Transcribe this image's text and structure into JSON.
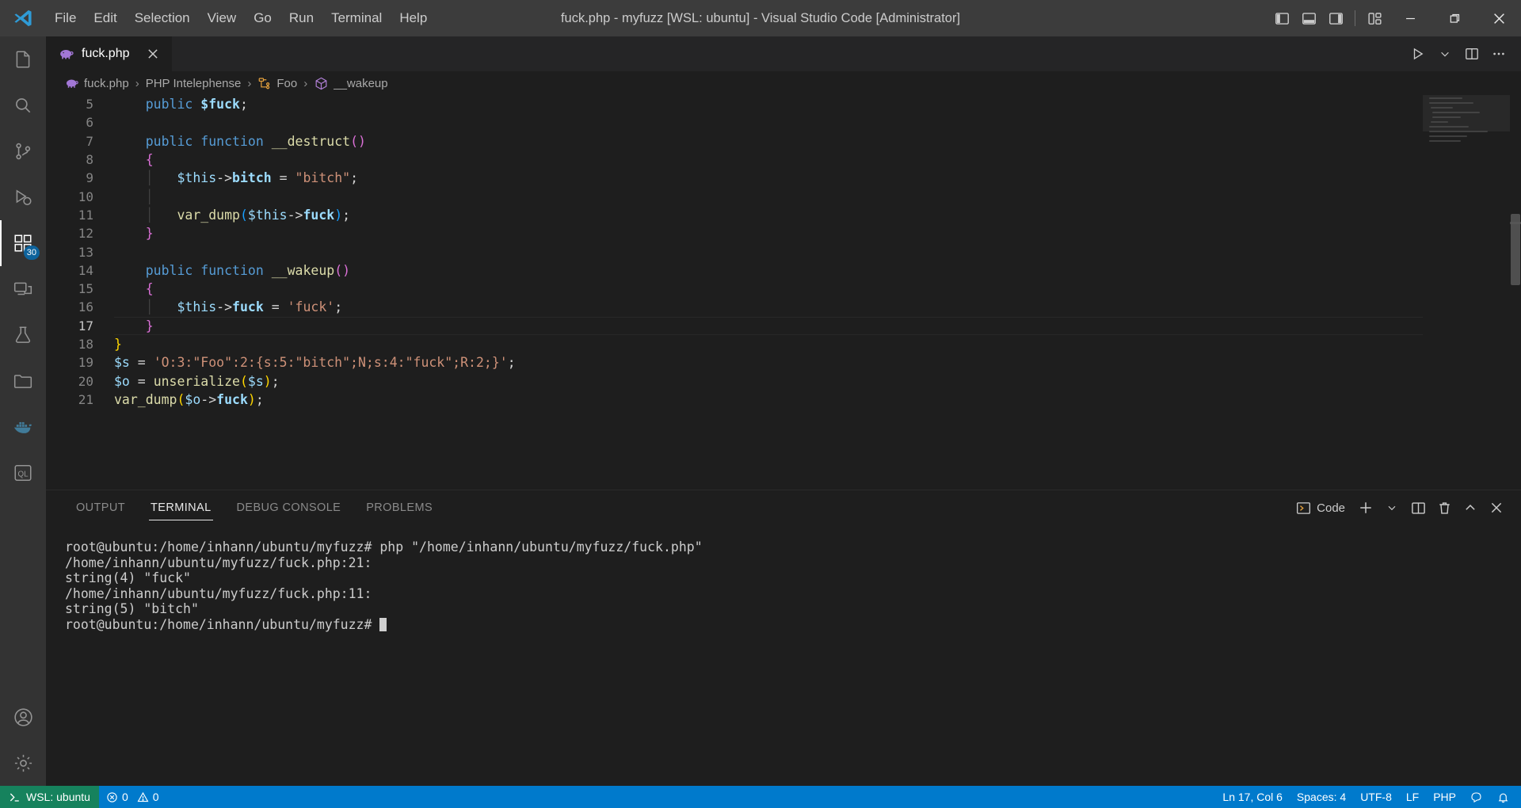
{
  "window": {
    "title": "fuck.php - myfuzz [WSL: ubuntu] - Visual Studio Code [Administrator]",
    "logo_icon": "vscode-logo-icon",
    "minimize_icon": "minimize-icon",
    "maximize_icon": "maximize-restore-icon",
    "close_icon": "close-icon"
  },
  "menubar": {
    "items": [
      {
        "label": "File"
      },
      {
        "label": "Edit"
      },
      {
        "label": "Selection"
      },
      {
        "label": "View"
      },
      {
        "label": "Go"
      },
      {
        "label": "Run"
      },
      {
        "label": "Terminal"
      },
      {
        "label": "Help"
      }
    ]
  },
  "layout_controls": [
    {
      "name": "toggle-primary-sidebar-icon"
    },
    {
      "name": "toggle-panel-icon"
    },
    {
      "name": "toggle-secondary-sidebar-icon"
    },
    {
      "name": "customize-layout-icon"
    }
  ],
  "activitybar": {
    "items": [
      {
        "name": "explorer",
        "icon": "files-icon",
        "badge": ""
      },
      {
        "name": "search",
        "icon": "search-icon",
        "badge": ""
      },
      {
        "name": "source-control",
        "icon": "source-control-icon",
        "badge": ""
      },
      {
        "name": "run-and-debug",
        "icon": "debug-icon",
        "badge": ""
      },
      {
        "name": "extensions",
        "icon": "extensions-icon",
        "badge": "30"
      },
      {
        "name": "remote-explorer",
        "icon": "remote-explorer-icon",
        "badge": ""
      },
      {
        "name": "testing",
        "icon": "beaker-icon",
        "badge": ""
      },
      {
        "name": "database-client",
        "icon": "database-folder-icon",
        "badge": ""
      },
      {
        "name": "docker",
        "icon": "docker-whale-icon",
        "badge": ""
      },
      {
        "name": "sql-tools",
        "icon": "sql-icon",
        "badge": ""
      }
    ],
    "bottom": [
      {
        "name": "accounts",
        "icon": "account-icon"
      },
      {
        "name": "manage",
        "icon": "gear-icon"
      }
    ]
  },
  "tabs": {
    "open": [
      {
        "label": "fuck.php",
        "icon": "php-elephant-icon",
        "active": true,
        "close_icon": "close-icon"
      }
    ],
    "actions": [
      {
        "name": "run-php-file",
        "icon": "play-icon"
      },
      {
        "name": "run-dropdown",
        "icon": "chevron-down-icon"
      },
      {
        "name": "split-editor-right",
        "icon": "split-editor-icon"
      },
      {
        "name": "more-actions",
        "icon": "ellipsis-icon"
      }
    ]
  },
  "breadcrumbs": {
    "items": [
      {
        "label": "fuck.php",
        "icon": "php-elephant-icon"
      },
      {
        "label": "PHP Intelephense",
        "icon": ""
      },
      {
        "label": "Foo",
        "icon": "class-icon"
      },
      {
        "label": "__wakeup",
        "icon": "method-icon"
      }
    ],
    "separator": "›"
  },
  "editor": {
    "first_line": 5,
    "active_line": 17,
    "lines": [
      {
        "n": 5,
        "tokens": [
          {
            "t": "pl",
            "v": "    "
          },
          {
            "t": "kw",
            "v": "public"
          },
          {
            "t": "pl",
            "v": " "
          },
          {
            "t": "prop",
            "v": "$fuck"
          },
          {
            "t": "pl",
            "v": ";"
          }
        ]
      },
      {
        "n": 6,
        "tokens": []
      },
      {
        "n": 7,
        "tokens": [
          {
            "t": "pl",
            "v": "    "
          },
          {
            "t": "kw",
            "v": "public"
          },
          {
            "t": "pl",
            "v": " "
          },
          {
            "t": "kw",
            "v": "function"
          },
          {
            "t": "pl",
            "v": " "
          },
          {
            "t": "fn",
            "v": "__destruct"
          },
          {
            "t": "b2",
            "v": "()"
          }
        ]
      },
      {
        "n": 8,
        "tokens": [
          {
            "t": "pl",
            "v": "    "
          },
          {
            "t": "b2",
            "v": "{"
          }
        ]
      },
      {
        "n": 9,
        "tokens": [
          {
            "t": "pl",
            "v": "    "
          },
          {
            "t": "ig",
            "v": "│"
          },
          {
            "t": "pl",
            "v": "   "
          },
          {
            "t": "var",
            "v": "$this"
          },
          {
            "t": "pl",
            "v": "->"
          },
          {
            "t": "prop",
            "v": "bitch"
          },
          {
            "t": "pl",
            "v": " = "
          },
          {
            "t": "str",
            "v": "\"bitch\""
          },
          {
            "t": "pl",
            "v": ";"
          }
        ]
      },
      {
        "n": 10,
        "tokens": [
          {
            "t": "pl",
            "v": "    "
          },
          {
            "t": "ig",
            "v": "│"
          }
        ]
      },
      {
        "n": 11,
        "tokens": [
          {
            "t": "pl",
            "v": "    "
          },
          {
            "t": "ig",
            "v": "│"
          },
          {
            "t": "pl",
            "v": "   "
          },
          {
            "t": "fn",
            "v": "var_dump"
          },
          {
            "t": "b3",
            "v": "("
          },
          {
            "t": "var",
            "v": "$this"
          },
          {
            "t": "pl",
            "v": "->"
          },
          {
            "t": "prop",
            "v": "fuck"
          },
          {
            "t": "b3",
            "v": ")"
          },
          {
            "t": "pl",
            "v": ";"
          }
        ]
      },
      {
        "n": 12,
        "tokens": [
          {
            "t": "pl",
            "v": "    "
          },
          {
            "t": "b2",
            "v": "}"
          }
        ]
      },
      {
        "n": 13,
        "tokens": []
      },
      {
        "n": 14,
        "tokens": [
          {
            "t": "pl",
            "v": "    "
          },
          {
            "t": "kw",
            "v": "public"
          },
          {
            "t": "pl",
            "v": " "
          },
          {
            "t": "kw",
            "v": "function"
          },
          {
            "t": "pl",
            "v": " "
          },
          {
            "t": "fn",
            "v": "__wakeup"
          },
          {
            "t": "b2",
            "v": "()"
          }
        ]
      },
      {
        "n": 15,
        "tokens": [
          {
            "t": "pl",
            "v": "    "
          },
          {
            "t": "b2",
            "v": "{"
          }
        ]
      },
      {
        "n": 16,
        "tokens": [
          {
            "t": "pl",
            "v": "    "
          },
          {
            "t": "ig",
            "v": "│"
          },
          {
            "t": "pl",
            "v": "   "
          },
          {
            "t": "var",
            "v": "$this"
          },
          {
            "t": "pl",
            "v": "->"
          },
          {
            "t": "prop",
            "v": "fuck"
          },
          {
            "t": "pl",
            "v": " = "
          },
          {
            "t": "str",
            "v": "'fuck'"
          },
          {
            "t": "pl",
            "v": ";"
          }
        ]
      },
      {
        "n": 17,
        "tokens": [
          {
            "t": "pl",
            "v": "    "
          },
          {
            "t": "b2",
            "v": "}"
          }
        ]
      },
      {
        "n": 18,
        "tokens": [
          {
            "t": "b1",
            "v": "}"
          }
        ]
      },
      {
        "n": 19,
        "tokens": [
          {
            "t": "var",
            "v": "$s"
          },
          {
            "t": "pl",
            "v": " = "
          },
          {
            "t": "str",
            "v": "'O:3:\"Foo\":2:{s:5:\"bitch\";N;s:4:\"fuck\";R:2;}'"
          },
          {
            "t": "pl",
            "v": ";"
          }
        ]
      },
      {
        "n": 20,
        "tokens": [
          {
            "t": "var",
            "v": "$o"
          },
          {
            "t": "pl",
            "v": " = "
          },
          {
            "t": "fn",
            "v": "unserialize"
          },
          {
            "t": "b1",
            "v": "("
          },
          {
            "t": "var",
            "v": "$s"
          },
          {
            "t": "b1",
            "v": ")"
          },
          {
            "t": "pl",
            "v": ";"
          }
        ]
      },
      {
        "n": 21,
        "tokens": [
          {
            "t": "fn",
            "v": "var_dump"
          },
          {
            "t": "b1",
            "v": "("
          },
          {
            "t": "var",
            "v": "$o"
          },
          {
            "t": "pl",
            "v": "->"
          },
          {
            "t": "prop",
            "v": "fuck"
          },
          {
            "t": "b1",
            "v": ")"
          },
          {
            "t": "pl",
            "v": ";"
          }
        ]
      }
    ]
  },
  "panel": {
    "tabs": [
      {
        "label": "OUTPUT",
        "active": false
      },
      {
        "label": "TERMINAL",
        "active": true
      },
      {
        "label": "DEBUG CONSOLE",
        "active": false
      },
      {
        "label": "PROBLEMS",
        "active": false
      }
    ],
    "actions": {
      "shell_label": "Code",
      "shell_icon": "terminal-icon",
      "new_terminal_icon": "plus-icon",
      "new_terminal_dropdown_icon": "chevron-down-icon",
      "split_terminal_icon": "split-icon",
      "kill_terminal_icon": "trash-icon",
      "maximize_panel_icon": "chevron-up-icon",
      "close_panel_icon": "close-icon"
    },
    "terminal": {
      "lines": [
        "root@ubuntu:/home/inhann/ubuntu/myfuzz# php \"/home/inhann/ubuntu/myfuzz/fuck.php\"",
        "/home/inhann/ubuntu/myfuzz/fuck.php:21:",
        "string(4) \"fuck\"",
        "/home/inhann/ubuntu/myfuzz/fuck.php:11:",
        "string(5) \"bitch\""
      ],
      "prompt": "root@ubuntu:/home/inhann/ubuntu/myfuzz# "
    }
  },
  "statusbar": {
    "remote": {
      "label": "WSL: ubuntu",
      "icon": "remote-indicator-icon"
    },
    "problems": {
      "errors": "0",
      "warnings": "0",
      "error_icon": "error-icon",
      "warning_icon": "warning-icon"
    },
    "right": [
      {
        "name": "editor-position",
        "label": "Ln 17, Col 6"
      },
      {
        "name": "editor-indentation",
        "label": "Spaces: 4"
      },
      {
        "name": "editor-encoding",
        "label": "UTF-8"
      },
      {
        "name": "editor-eol",
        "label": "LF"
      },
      {
        "name": "editor-language",
        "label": "PHP"
      },
      {
        "name": "notifications-bell",
        "label": ""
      },
      {
        "name": "feedback",
        "label": ""
      }
    ]
  },
  "colors": {
    "statusbar_bg": "#007acc",
    "remote_bg": "#16825d",
    "accent_badge": "#0e639c",
    "editor_bg": "#1e1e1e",
    "activitybar_bg": "#333333",
    "titlebar_bg": "#3c3c3c"
  }
}
